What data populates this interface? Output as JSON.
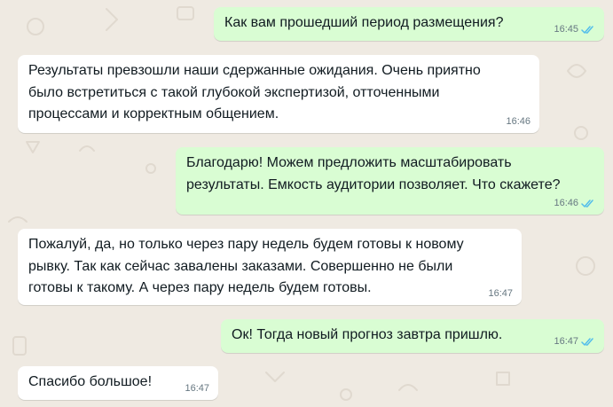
{
  "chat": {
    "messages": [
      {
        "direction": "outgoing",
        "text": "Как вам прошедший период размещения?",
        "time": "16:45",
        "status": "read"
      },
      {
        "direction": "incoming",
        "text": "Результаты превзошли наши сдержанные ожидания. Очень приятно\nбыло встретиться с такой глубокой экспертизой, отточенными\nпроцессами и корректным общением.",
        "time": "16:46"
      },
      {
        "direction": "outgoing",
        "text": "Благодарю! Можем предложить масштабировать\nрезультаты. Емкость аудитории позволяет. Что скажете?",
        "time": "16:46",
        "status": "read"
      },
      {
        "direction": "incoming",
        "text": "Пожалуй, да, но только через пару недель будем готовы к новому\nрывку. Так как сейчас завалены заказами. Совершенно не были\nготовы к такому. А через пару недель будем готовы.",
        "time": "16:47"
      },
      {
        "direction": "outgoing",
        "text": "Ок! Тогда новый прогноз завтра пришлю.",
        "time": "16:47",
        "status": "read"
      },
      {
        "direction": "incoming",
        "text": "Спасибо большое!",
        "time": "16:47"
      }
    ]
  },
  "colors": {
    "background": "#efeae2",
    "incoming_bubble": "#ffffff",
    "outgoing_bubble": "#d9fdd3",
    "read_ticks": "#53bdeb",
    "timestamp": "#667781"
  },
  "icons": {
    "read_status": "double-check-icon"
  }
}
